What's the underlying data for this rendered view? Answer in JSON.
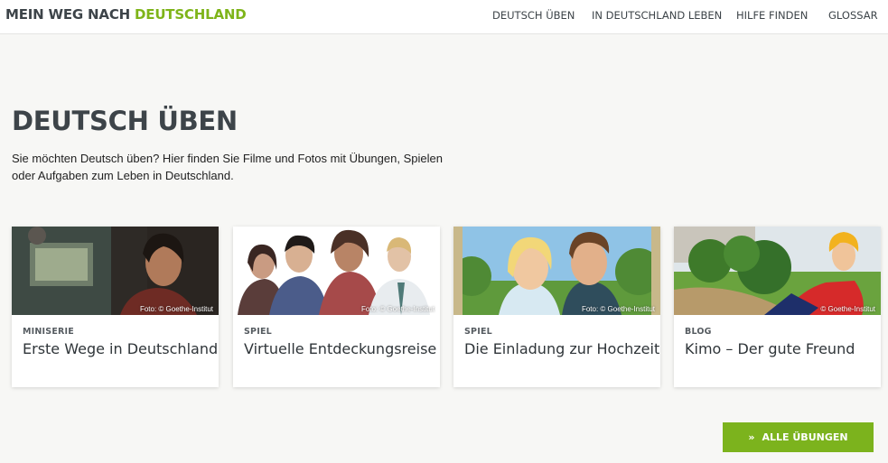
{
  "site": {
    "logo_part1": "MEIN WEG NACH",
    "logo_part2": "DEUTSCHLAND"
  },
  "nav": [
    {
      "label": "DEUTSCH ÜBEN"
    },
    {
      "label": "IN DEUTSCHLAND LEBEN"
    },
    {
      "label": "HILFE FINDEN"
    },
    {
      "label": "GLOSSAR"
    }
  ],
  "page": {
    "title": "DEUTSCH ÜBEN",
    "intro_line1": "Sie möchten Deutsch üben? Hier finden Sie Filme und Fotos mit Übungen, Spielen",
    "intro_line2": "oder Aufgaben zum Leben in Deutschland."
  },
  "cards": [
    {
      "category": "MINISERIE",
      "title": "Erste Wege in Deutschland",
      "credit": "Foto: © Goethe-Institut"
    },
    {
      "category": "SPIEL",
      "title": "Virtuelle Entdeckungsreise",
      "credit": "Foto: © Goethe-Institut"
    },
    {
      "category": "SPIEL",
      "title": "Die Einladung zur Hochzeit",
      "credit": "Foto: © Goethe-Institut"
    },
    {
      "category": "BLOG",
      "title": "Kimo – Der gute Freund",
      "credit": "© Goethe-Institut"
    }
  ],
  "button": {
    "icon": "double-chevron-right-icon",
    "label": "ALLE ÜBUNGEN"
  },
  "colors": {
    "accent": "#7cb31d",
    "text": "#3d4449",
    "background": "#f7f7f5"
  }
}
